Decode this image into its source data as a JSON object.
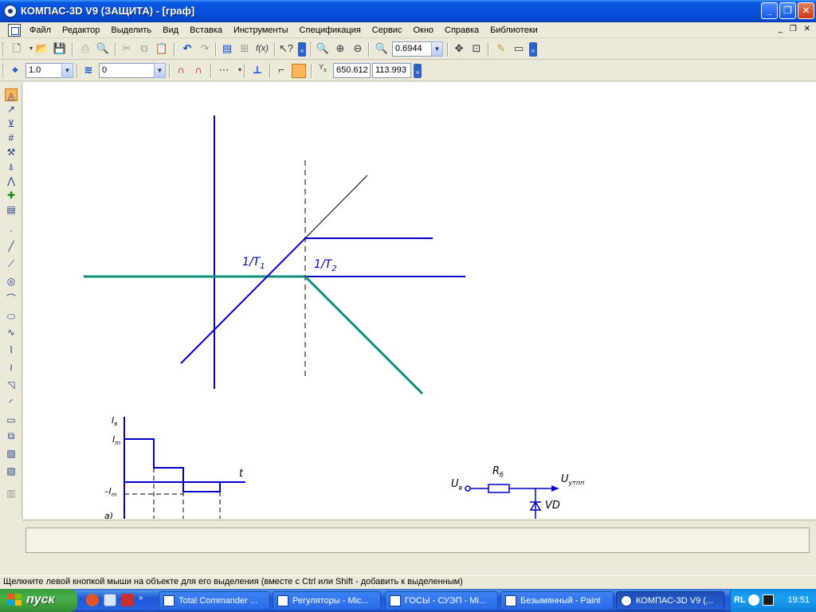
{
  "window": {
    "title": "КОМПАС-3D V9 (ЗАЩИТА) - [граф]"
  },
  "menu": {
    "items": [
      "Файл",
      "Редактор",
      "Выделить",
      "Вид",
      "Вставка",
      "Инструменты",
      "Спецификация",
      "Сервис",
      "Окно",
      "Справка",
      "Библиотеки"
    ]
  },
  "toolbar_main": {
    "zoom_value": "0.6944"
  },
  "toolbar_props": {
    "line_scale": "1.0",
    "layer": "0",
    "coord_x": "650.612",
    "coord_y": "113.993",
    "coord_icon_label": "Y",
    "coord_icon_sub": "x"
  },
  "drawing": {
    "label_t1": "1/T",
    "label_t1_sub": "1",
    "label_t2": "1/T",
    "label_t2_sub": "2",
    "small_plot": {
      "y_axis": "I",
      "y_axis_sub": "в",
      "im_top": "I",
      "im_top_sub": "m",
      "im_neg": "–I",
      "im_neg_sub": "m",
      "t_axis": "t",
      "cut_label": "а)"
    },
    "circuit": {
      "input": "U",
      "input_sub": "в",
      "resistor": "R",
      "resistor_sub": "б",
      "output": "U",
      "output_sub": "утпп",
      "diode": "VD"
    }
  },
  "status": {
    "text": "Щелкните левой кнопкой мыши на объекте для его выделения (вместе с Ctrl или Shift - добавить к выделенным)"
  },
  "taskbar": {
    "start_label": "пуск",
    "tasks": [
      "Total Commander ...",
      "Регуляторы - Mic...",
      "ГОСЫ - СУЭП - Mi...",
      "Безымянный - Paint",
      "КОМПАС-3D V9 (..."
    ],
    "lang": "RL",
    "clock": "19:51"
  },
  "colors": {
    "blue_line": "#0000cc",
    "green_line": "#10907a",
    "accent_orange": "#ffb55a"
  }
}
